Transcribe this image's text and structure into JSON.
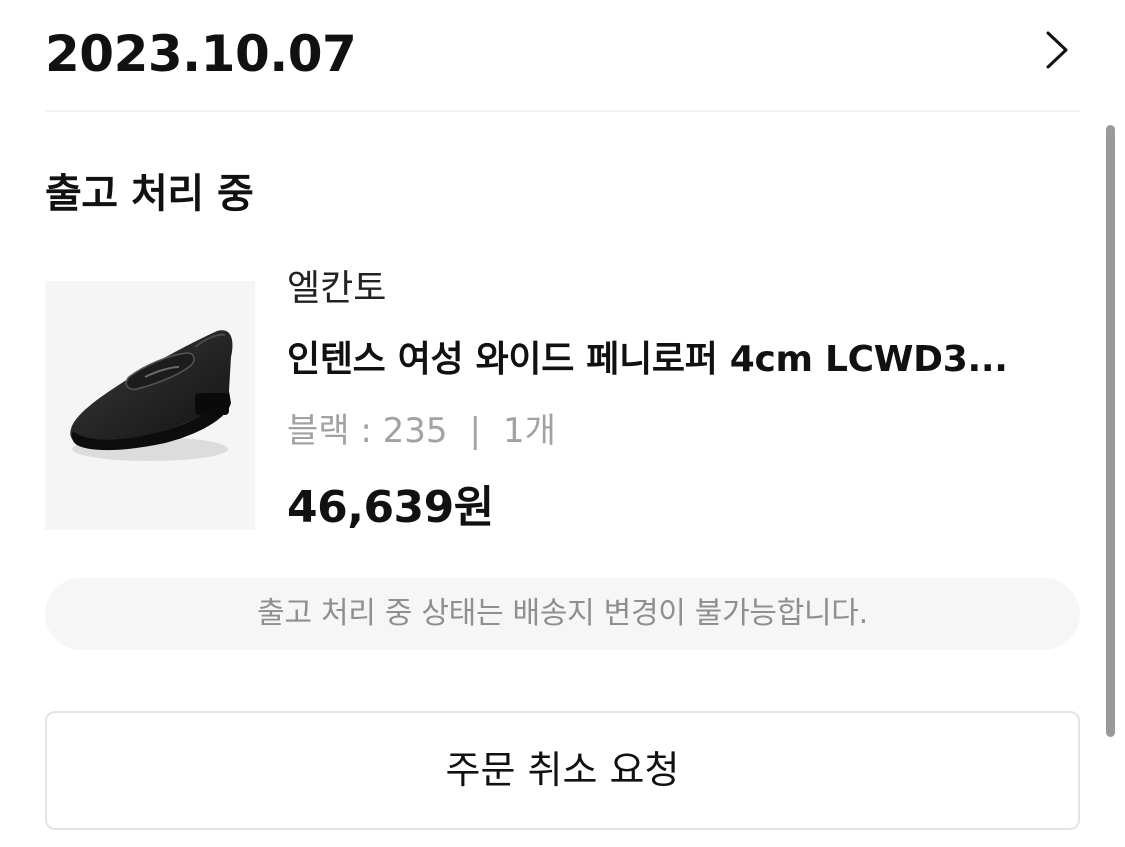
{
  "order": {
    "date": "2023.10.07",
    "status": "출고 처리 중"
  },
  "product": {
    "brand": "엘칸토",
    "name": "인텐스 여성 와이드 페니로퍼 4cm LCWD3...",
    "option": "블랙 : 235",
    "quantity": "1개",
    "price": "46,639원",
    "image": "black-penny-loafer-image"
  },
  "notice": "출고 처리 중 상태는 배송지 변경이 불가능합니다.",
  "actions": {
    "cancel_label": "주문 취소 요청"
  },
  "icons": {
    "detail": "chevron-right-icon"
  },
  "colors": {
    "text_primary": "#111111",
    "text_secondary": "#a2a2a2",
    "notice_bg": "#f6f6f6",
    "button_border": "#e4e4e4"
  }
}
